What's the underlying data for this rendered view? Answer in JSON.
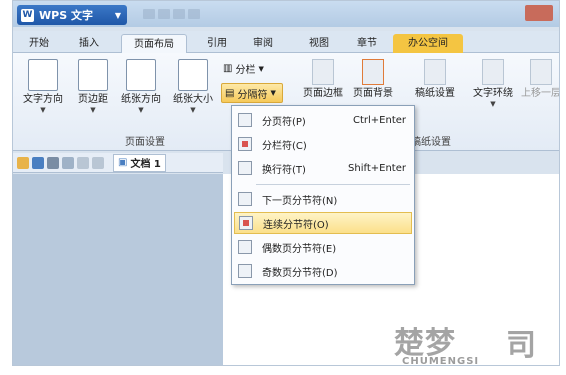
{
  "app": {
    "title": "WPS 文字"
  },
  "tabs": [
    "开始",
    "插入",
    "页面布局",
    "引用",
    "审阅",
    "视图",
    "章节",
    "办公空间"
  ],
  "ribbon": {
    "text_direction": "文字方向",
    "margins": "页边距",
    "orientation": "纸张方向",
    "size": "纸张大小",
    "columns": "分栏",
    "separator": "分隔符",
    "page_borders": "页面边框",
    "background": "页面背景",
    "draft_settings": "稿纸设置",
    "text_wrap": "文字环绕",
    "bring_forward": "上移一层",
    "group_page_setup": "页面设置",
    "group_draft": "稿纸设置"
  },
  "doc_tab": {
    "label": "文档 1"
  },
  "menu": {
    "items": [
      {
        "label": "分页符(P)",
        "shortcut": "Ctrl+Enter",
        "icon": "page-break-icon"
      },
      {
        "label": "分栏符(C)",
        "shortcut": "",
        "icon": "column-break-icon"
      },
      {
        "label": "换行符(T)",
        "shortcut": "Shift+Enter",
        "icon": "line-break-icon"
      },
      {
        "label": "下一页分节符(N)",
        "shortcut": "",
        "icon": "next-page-section-icon"
      },
      {
        "label": "连续分节符(O)",
        "shortcut": "",
        "icon": "continuous-section-icon"
      },
      {
        "label": "偶数页分节符(E)",
        "shortcut": "",
        "icon": "even-page-section-icon"
      },
      {
        "label": "奇数页分节符(D)",
        "shortcut": "",
        "icon": "odd-page-section-icon"
      }
    ],
    "highlighted_index": 4
  },
  "watermark": {
    "text": "楚梦",
    "sub": "CHUMENGSI"
  },
  "colors": {
    "accent": "#1f57a8",
    "highlight": "#fbe08a",
    "office_tab": "#f4c542"
  }
}
